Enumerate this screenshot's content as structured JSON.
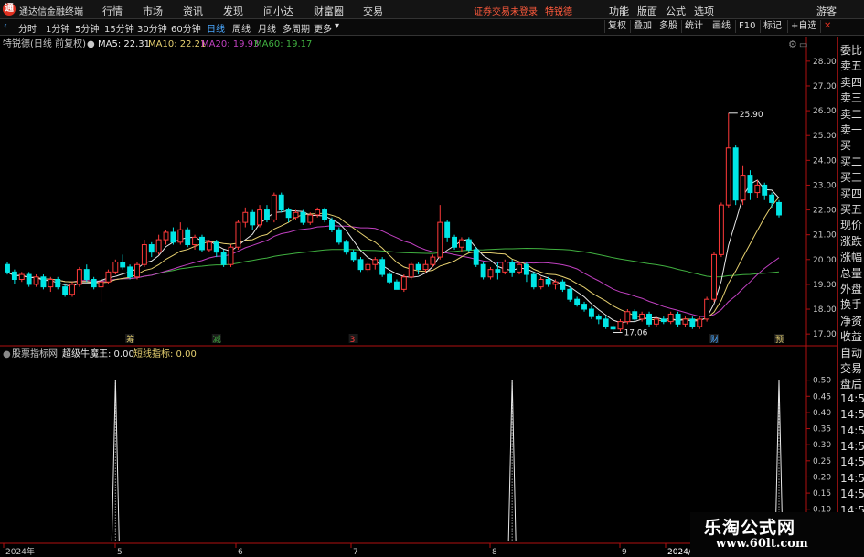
{
  "app": {
    "title": "通达信金融终端",
    "menu": [
      "行情",
      "市场",
      "资讯",
      "发现",
      "问小达",
      "财富圈",
      "交易"
    ],
    "notice": "证券交易未登录",
    "stock_link": "特锐德",
    "right_menu": [
      "功能",
      "版面",
      "公式",
      "选项"
    ],
    "guest": "游客"
  },
  "toolbar": {
    "periods": [
      "分时",
      "1分钟",
      "5分钟",
      "15分钟",
      "30分钟",
      "60分钟",
      "日线",
      "周线",
      "月线",
      "多周期",
      "更多"
    ],
    "active_period": "日线",
    "right_buttons": [
      "复权",
      "叠加",
      "多股",
      "统计",
      "画线",
      "F10",
      "标记",
      "+自选"
    ]
  },
  "main_legend": {
    "stock": "特锐德(日线 前复权)",
    "ma5": "MA5: 22.31",
    "ma10": "MA10: 22.21",
    "ma20": "MA20: 19.93",
    "ma60": "MA60: 19.17"
  },
  "colors": {
    "up": "#ff3a3a",
    "down": "#00e6e6",
    "ma5": "#e8e8e8",
    "ma10": "#e6d070",
    "ma20": "#c040c0",
    "ma60": "#40b040",
    "indicator": "#e8e8e8",
    "axis": "#b01010"
  },
  "sub_legend": {
    "source": "股票指标网",
    "name": "超级牛魔王: 0.00",
    "short": "短线指标: 0.00"
  },
  "side_panel": [
    "委比",
    "卖五",
    "卖四",
    "卖三",
    "卖二",
    "卖一",
    "买一",
    "买二",
    "买三",
    "买四",
    "买五",
    "现价",
    "涨跌",
    "涨幅",
    "总量",
    "外盘",
    "换手",
    "净资",
    "收益",
    "自动",
    "交易",
    "盘后",
    "14:5",
    "14:5",
    "14:5",
    "14:5",
    "14:5",
    "14:5",
    "14:5",
    "14:5",
    "14:5"
  ],
  "watermark": {
    "line1": "乐淘公式网",
    "line2": "www.60lt.com"
  },
  "chart_data": {
    "type": "candlestick",
    "price_axis": {
      "ticks": [
        "28.00",
        "27.00",
        "26.00",
        "25.00",
        "24.00",
        "23.00",
        "22.00",
        "21.00",
        "20.00",
        "19.00",
        "18.00",
        "17.00"
      ],
      "ylim": [
        16.6,
        28.4
      ]
    },
    "indicator_axis": {
      "ticks": [
        "0.50",
        "0.45",
        "0.40",
        "0.35",
        "0.30",
        "0.25",
        "0.20",
        "0.15",
        "0.10",
        "0.05"
      ],
      "ylim": [
        0,
        0.55
      ]
    },
    "x_labels": [
      "2024年",
      "5",
      "6",
      "7",
      "8",
      "9",
      "2024/"
    ],
    "annotations": {
      "high": "25.90",
      "low": "17.06"
    },
    "event_markers": [
      "筹",
      "减",
      "3",
      "财",
      "预"
    ],
    "candles": [
      [
        19.8,
        19.5,
        19.9,
        19.4
      ],
      [
        19.5,
        19.2,
        19.6,
        19.0
      ],
      [
        19.2,
        19.4,
        19.5,
        19.1
      ],
      [
        19.4,
        19.0,
        19.5,
        18.9
      ],
      [
        19.0,
        19.3,
        19.4,
        18.9
      ],
      [
        19.3,
        18.9,
        19.4,
        18.8
      ],
      [
        18.9,
        19.2,
        19.3,
        18.7
      ],
      [
        19.2,
        18.9,
        19.3,
        18.8
      ],
      [
        18.9,
        18.6,
        19.0,
        18.5
      ],
      [
        18.6,
        19.0,
        19.1,
        18.5
      ],
      [
        19.0,
        19.6,
        19.7,
        18.9
      ],
      [
        19.6,
        19.2,
        19.8,
        19.1
      ],
      [
        19.2,
        18.9,
        19.3,
        18.8
      ],
      [
        18.9,
        19.1,
        19.2,
        18.3
      ],
      [
        19.1,
        19.5,
        19.6,
        19.0
      ],
      [
        19.5,
        19.9,
        20.0,
        19.4
      ],
      [
        19.9,
        19.7,
        20.2,
        19.6
      ],
      [
        19.7,
        19.3,
        19.8,
        19.2
      ],
      [
        19.3,
        19.8,
        19.9,
        19.2
      ],
      [
        19.8,
        20.6,
        20.8,
        19.7
      ],
      [
        20.6,
        20.3,
        20.7,
        20.1
      ],
      [
        20.3,
        20.8,
        21.0,
        20.2
      ],
      [
        20.8,
        21.1,
        21.2,
        20.6
      ],
      [
        21.1,
        20.7,
        21.3,
        20.6
      ],
      [
        20.7,
        21.2,
        21.5,
        20.6
      ],
      [
        21.2,
        20.6,
        21.3,
        20.5
      ],
      [
        20.6,
        20.9,
        21.0,
        20.4
      ],
      [
        20.9,
        20.4,
        21.0,
        20.3
      ],
      [
        20.4,
        20.7,
        20.8,
        20.3
      ],
      [
        20.7,
        20.3,
        20.8,
        20.1
      ],
      [
        20.3,
        19.8,
        20.4,
        19.7
      ],
      [
        19.8,
        20.5,
        20.6,
        19.7
      ],
      [
        20.5,
        21.5,
        21.6,
        20.4
      ],
      [
        21.5,
        21.9,
        22.1,
        21.3
      ],
      [
        21.9,
        21.4,
        22.0,
        21.2
      ],
      [
        21.4,
        22.0,
        22.2,
        21.3
      ],
      [
        22.0,
        21.6,
        22.2,
        21.5
      ],
      [
        21.6,
        22.6,
        22.7,
        21.5
      ],
      [
        22.6,
        22.0,
        22.7,
        21.9
      ],
      [
        22.0,
        21.7,
        22.1,
        21.5
      ],
      [
        21.7,
        21.9,
        22.0,
        21.6
      ],
      [
        21.9,
        21.5,
        22.0,
        21.4
      ],
      [
        21.5,
        21.8,
        21.9,
        21.4
      ],
      [
        21.8,
        22.0,
        22.1,
        21.7
      ],
      [
        22.0,
        21.6,
        22.1,
        21.5
      ],
      [
        21.6,
        21.2,
        21.7,
        21.1
      ],
      [
        21.2,
        20.7,
        21.3,
        20.6
      ],
      [
        20.7,
        20.3,
        20.8,
        20.2
      ],
      [
        20.3,
        20.0,
        20.4,
        19.9
      ],
      [
        20.0,
        19.6,
        20.1,
        19.5
      ],
      [
        19.6,
        19.8,
        19.9,
        19.5
      ],
      [
        19.8,
        20.0,
        20.1,
        19.6
      ],
      [
        20.0,
        19.4,
        20.1,
        19.3
      ],
      [
        19.4,
        19.1,
        19.5,
        19.0
      ],
      [
        19.1,
        18.8,
        19.2,
        18.9
      ],
      [
        18.8,
        19.3,
        19.4,
        18.7
      ],
      [
        19.3,
        19.8,
        19.9,
        19.2
      ],
      [
        19.8,
        19.6,
        19.9,
        19.4
      ],
      [
        19.6,
        19.8,
        20.0,
        19.5
      ],
      [
        19.8,
        20.1,
        20.2,
        19.7
      ],
      [
        20.1,
        21.5,
        22.2,
        20.0
      ],
      [
        21.5,
        20.9,
        21.6,
        20.7
      ],
      [
        20.9,
        20.5,
        21.0,
        20.4
      ],
      [
        20.5,
        20.8,
        20.9,
        20.3
      ],
      [
        20.8,
        20.4,
        20.9,
        20.3
      ],
      [
        20.4,
        19.8,
        20.5,
        19.7
      ],
      [
        19.8,
        19.3,
        19.9,
        19.2
      ],
      [
        19.3,
        19.6,
        19.7,
        19.2
      ],
      [
        19.6,
        19.5,
        19.9,
        19.2
      ],
      [
        19.5,
        19.9,
        20.0,
        19.4
      ],
      [
        19.9,
        19.5,
        20.0,
        19.3
      ],
      [
        19.5,
        19.8,
        19.9,
        19.4
      ],
      [
        19.8,
        19.4,
        19.9,
        19.1
      ],
      [
        19.4,
        18.9,
        19.5,
        18.8
      ],
      [
        18.9,
        19.2,
        19.3,
        18.8
      ],
      [
        19.2,
        19.0,
        19.3,
        18.9
      ],
      [
        19.0,
        19.1,
        19.2,
        18.8
      ],
      [
        19.1,
        18.8,
        19.2,
        18.7
      ],
      [
        18.8,
        18.4,
        18.9,
        18.3
      ],
      [
        18.4,
        18.2,
        18.5,
        18.1
      ],
      [
        18.2,
        18.0,
        18.3,
        17.9
      ],
      [
        18.0,
        17.7,
        18.1,
        17.6
      ],
      [
        17.7,
        17.6,
        17.8,
        17.4
      ],
      [
        17.6,
        17.3,
        17.7,
        17.2
      ],
      [
        17.3,
        17.2,
        17.4,
        17.06
      ],
      [
        17.2,
        17.5,
        17.6,
        17.1
      ],
      [
        17.5,
        17.9,
        18.0,
        17.4
      ],
      [
        17.9,
        17.6,
        18.0,
        17.5
      ],
      [
        17.6,
        17.8,
        17.9,
        17.5
      ],
      [
        17.8,
        17.4,
        17.9,
        17.3
      ],
      [
        17.4,
        17.6,
        17.7,
        17.3
      ],
      [
        17.6,
        17.5,
        17.7,
        17.4
      ],
      [
        17.5,
        17.8,
        17.9,
        17.4
      ],
      [
        17.8,
        17.4,
        17.9,
        17.3
      ],
      [
        17.4,
        17.6,
        17.7,
        17.3
      ],
      [
        17.6,
        17.3,
        17.7,
        17.2
      ],
      [
        17.3,
        17.6,
        17.7,
        17.2
      ],
      [
        17.6,
        18.4,
        18.5,
        17.5
      ],
      [
        18.4,
        20.2,
        20.3,
        18.3
      ],
      [
        20.2,
        22.2,
        22.3,
        20.1
      ],
      [
        22.2,
        24.5,
        25.9,
        22.1
      ],
      [
        24.5,
        22.4,
        24.6,
        22.2
      ],
      [
        22.4,
        23.4,
        23.8,
        22.2
      ],
      [
        23.4,
        22.7,
        23.6,
        22.4
      ],
      [
        22.7,
        23.0,
        23.2,
        22.5
      ],
      [
        23.0,
        22.6,
        23.1,
        22.4
      ],
      [
        22.6,
        22.3,
        22.7,
        22.1
      ],
      [
        22.3,
        21.8,
        22.4,
        21.7
      ]
    ],
    "indicator_spikes": [
      15,
      70,
      123
    ],
    "indicator_spike_value": 0.5
  }
}
